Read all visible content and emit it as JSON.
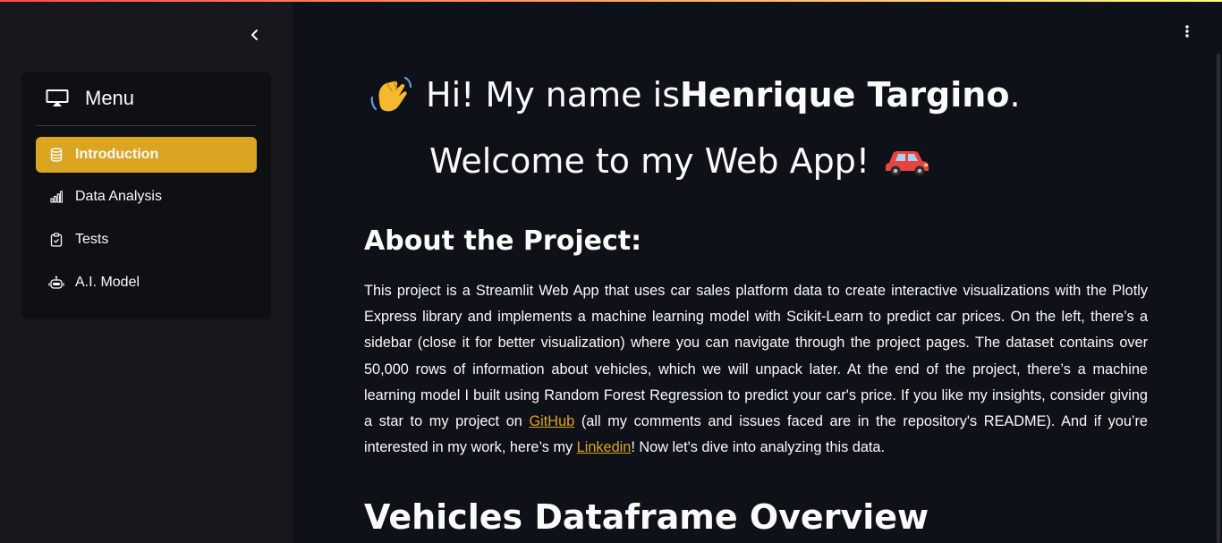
{
  "sidebar": {
    "collapse_icon": "chevron-left-icon",
    "menu": {
      "icon": "monitor-icon",
      "title": "Menu",
      "items": [
        {
          "label": "Introduction",
          "icon": "database-icon",
          "active": true
        },
        {
          "label": "Data Analysis",
          "icon": "bar-chart-icon",
          "active": false
        },
        {
          "label": "Tests",
          "icon": "clipboard-check-icon",
          "active": false
        },
        {
          "label": "A.I. Model",
          "icon": "robot-icon",
          "active": false
        }
      ]
    }
  },
  "header": {
    "menu_icon": "kebab-menu-icon"
  },
  "main": {
    "greeting_prefix": "Hi! My name is ",
    "greeting_name": "Henrique Targino",
    "greeting_suffix": ".",
    "welcome": "Welcome to my Web App!",
    "about_heading": "About the Project:",
    "about_p1": "This project is a Streamlit Web App that uses car sales platform data to create interactive visualizations with the Plotly Express library and implements a machine learning model with Scikit-Learn to predict car prices. On the left, there’s a sidebar (close it for better visualization) where you can navigate through the project pages. The dataset contains over 50,000 rows of information about vehicles, which we will unpack later. At the end of the project, there’s a machine learning model I built using Random Forest Regression to predict your car's price. If you like my insights, consider giving a star to my project on ",
    "github_link": "GitHub",
    "about_p2": " (all my comments and issues faced are in the repository's README). And if you’re interested in my work, here’s my ",
    "linkedin_link": "Linkedin",
    "about_p3": "! Now let's dive into analyzing this data.",
    "overview_heading": "Vehicles Dataframe Overview"
  },
  "colors": {
    "accent": "#dba521",
    "background": "#0e1117",
    "sidebar": "#16181d"
  }
}
